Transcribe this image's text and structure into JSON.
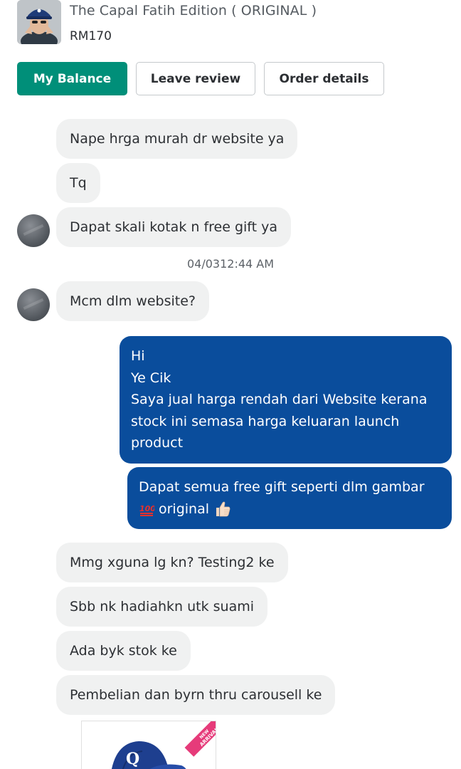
{
  "product": {
    "title": "The Capal Fatih Edition ( ORIGINAL )",
    "price": "RM170"
  },
  "actions": {
    "balance": "My Balance",
    "review": "Leave review",
    "order": "Order details"
  },
  "messages": {
    "m1": "Nape hrga murah dr website ya",
    "m2": "Tq",
    "m3": "Dapat skali kotak n free gift ya",
    "timestamp": "04/0312:44 AM",
    "m4": "Mcm dlm website?",
    "out1": [
      "Hi",
      "Ye Cik",
      "Saya jual harga rendah dari Website kerana",
      "stock ini semasa harga keluaran launch",
      "product"
    ],
    "out2_line1": "Dapat semua free gift seperti dlm gambar",
    "out2_line2": "original",
    "out2_emoji": [
      "hundred-points-emoji",
      "thumbs-up-emoji"
    ],
    "m5": "Mmg xguna lg kn? Testing2 ke",
    "m6": "Sbb nk hadiahkn utk suami",
    "m7": "Ada byk stok ke",
    "m8": "Pembelian dan byrn thru carousell ke"
  },
  "attachment": {
    "ribbon": [
      "NEW",
      "ARRIVAL"
    ]
  },
  "colors": {
    "accent": "#008f79",
    "outgoing": "#0a4d9c",
    "incoming": "#f0f1f1"
  }
}
